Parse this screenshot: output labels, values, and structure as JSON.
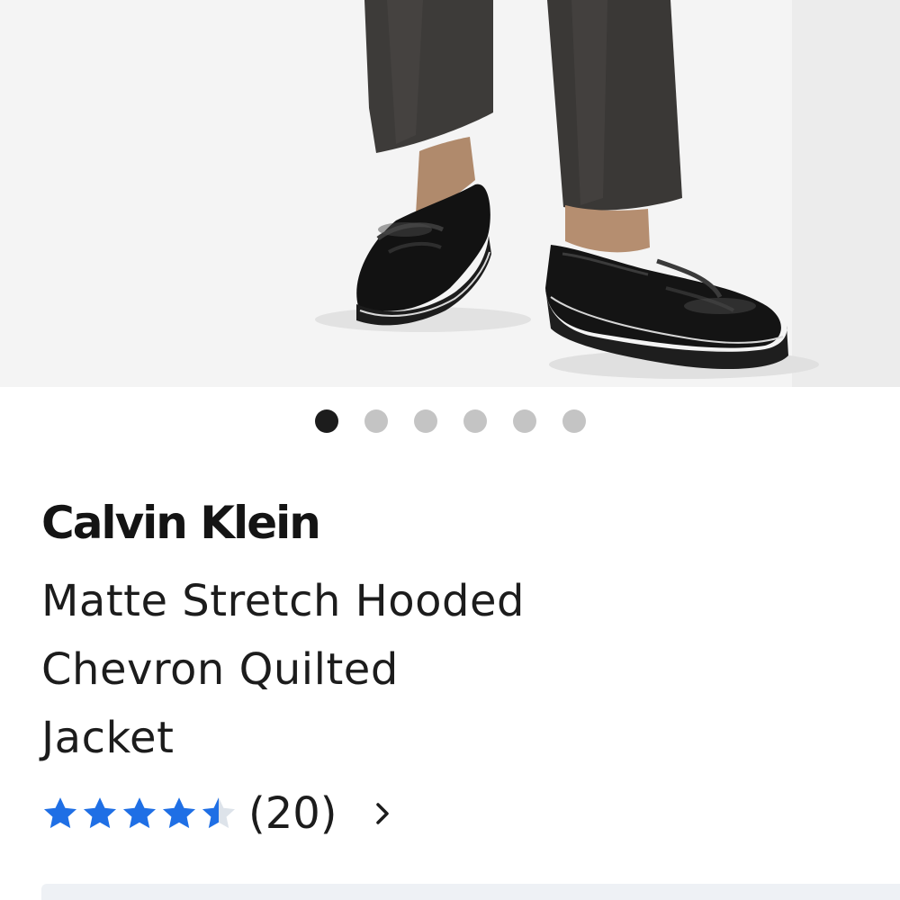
{
  "product": {
    "brand": "Calvin Klein",
    "name_lines": [
      "Matte Stretch Hooded",
      "Chevron Quilted",
      "Jacket"
    ],
    "image": {
      "description_icon": "product-photo",
      "background": "#f3f3f3"
    }
  },
  "carousel": {
    "total": 6,
    "active_index": 0,
    "colors": {
      "active": "#1c1c1c",
      "inactive": "#c4c4c4"
    }
  },
  "rating": {
    "value": 4.5,
    "max": 5,
    "count_text": "(20)",
    "star_color": "#1f6fe5",
    "empty_star_color": "#dde3ea",
    "chevron_icon": "chevron-right-icon"
  }
}
